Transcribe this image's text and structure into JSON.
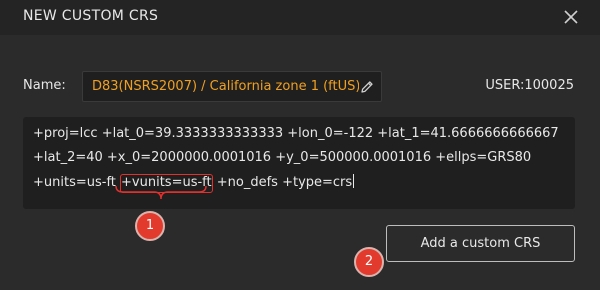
{
  "dialog": {
    "title": "NEW CUSTOM CRS",
    "close_icon": "close-icon"
  },
  "name": {
    "label": "Name:",
    "value": "D83(NSRS2007) / California zone 1 (ftUS)",
    "edit_icon": "pencil-icon"
  },
  "user_id": "USER:100025",
  "proj": {
    "line1": "+proj=lcc +lat_0=39.3333333333333 +lon_0=-122 +lat_1=41.6666666666667",
    "line2": "+lat_2=40 +x_0=2000000.0001016 +y_0=500000.0001016 +ellps=GRS80",
    "line3_pre": "+units=us-ft ",
    "line3_highlight": "+vunits=us-ft",
    "line3_post": " +no_defs +type=crs"
  },
  "annotations": {
    "marker1": "1",
    "marker2": "2",
    "color": "#e23b2e"
  },
  "actions": {
    "add_label": "Add a custom CRS"
  },
  "colors": {
    "background": "#2b2b2b",
    "header": "#242424",
    "field": "#1f1f1f",
    "name_text": "#f0a020",
    "highlight": "#e0312e"
  }
}
